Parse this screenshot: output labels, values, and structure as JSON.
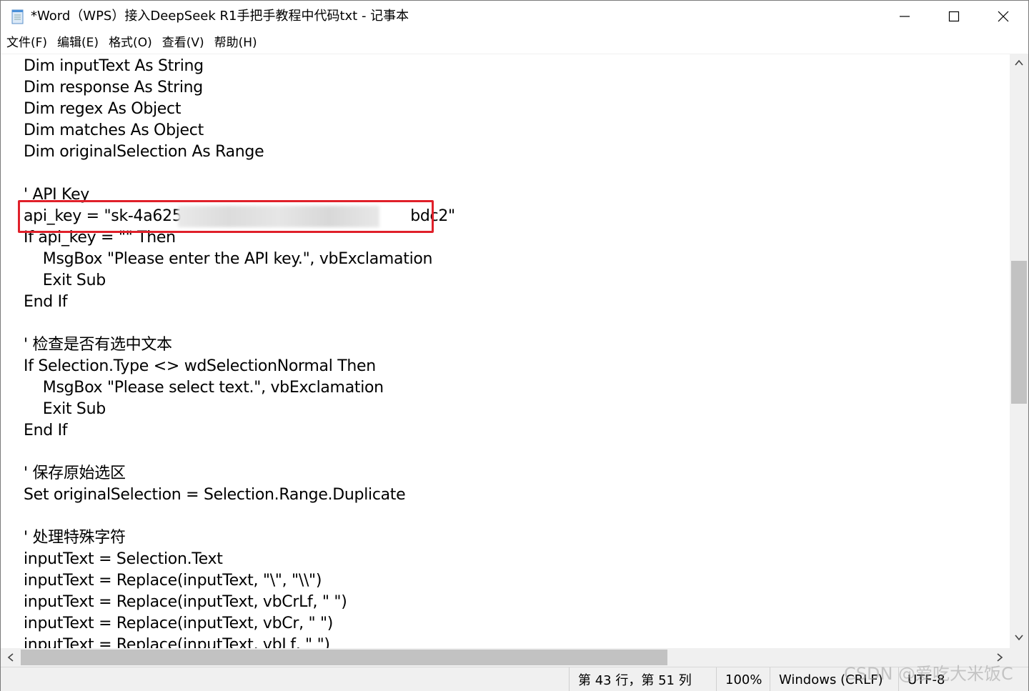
{
  "window": {
    "title": "*Word（WPS）接入DeepSeek R1手把手教程中代码txt - 记事本",
    "app_icon": "notepad-icon"
  },
  "controls": {
    "minimize_icon": "minimize-icon",
    "maximize_icon": "maximize-icon",
    "close_icon": "close-icon"
  },
  "menu": [
    {
      "label": "文件(F)"
    },
    {
      "label": "编辑(E)"
    },
    {
      "label": "格式(O)"
    },
    {
      "label": "查看(V)"
    },
    {
      "label": "帮助(H)"
    }
  ],
  "editor": {
    "lines": [
      "Dim inputText As String",
      "Dim response As String",
      "Dim regex As Object",
      "Dim matches As Object",
      "Dim originalSelection As Range",
      "",
      "' API Key",
      "api_key = \"sk-4a625c                                              bdc2\"",
      "If api_key = \"\" Then",
      "    MsgBox \"Please enter the API key.\", vbExclamation",
      "    Exit Sub",
      "End If",
      "",
      "' 检查是否有选中文本",
      "If Selection.Type <> wdSelectionNormal Then",
      "    MsgBox \"Please select text.\", vbExclamation",
      "    Exit Sub",
      "End If",
      "",
      "' 保存原始选区",
      "Set originalSelection = Selection.Range.Duplicate",
      "",
      "' 处理特殊字符",
      "inputText = Selection.Text",
      "inputText = Replace(inputText, \"\\\", \"\\\\\")",
      "inputText = Replace(inputText, vbCrLf, \" \")",
      "inputText = Replace(inputText, vbCr, \" \")",
      "inputText = Replace(inputText, vbLf, \" \")"
    ],
    "highlight_color": "#e0202a"
  },
  "statusbar": {
    "position": "第 43 行，第 51 列",
    "zoom": "100%",
    "line_ending": "Windows (CRLF)",
    "encoding": "UTF-8"
  },
  "watermark": "CSDN @爱吃大米饭C"
}
